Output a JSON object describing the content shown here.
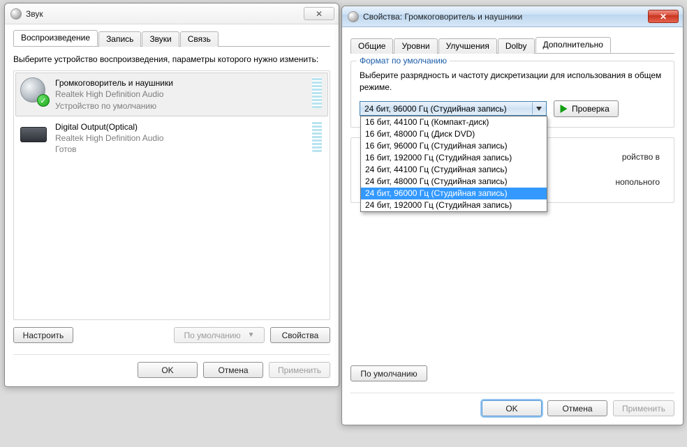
{
  "sound_window": {
    "title": "Звук",
    "tabs": [
      "Воспроизведение",
      "Запись",
      "Звуки",
      "Связь"
    ],
    "active_tab": 0,
    "instruction": "Выберите устройство воспроизведения, параметры которого нужно изменить:",
    "devices": [
      {
        "name": "Громкоговоритель и наушники",
        "driver": "Realtek High Definition Audio",
        "status": "Устройство по умолчанию",
        "selected": true,
        "icon": "speaker",
        "default_check": true
      },
      {
        "name": "Digital Output(Optical)",
        "driver": "Realtek High Definition Audio",
        "status": "Готов",
        "selected": false,
        "icon": "optical",
        "default_check": false
      }
    ],
    "buttons": {
      "configure": "Настроить",
      "set_default": "По умолчанию",
      "properties": "Свойства",
      "ok": "OK",
      "cancel": "Отмена",
      "apply": "Применить"
    }
  },
  "props_window": {
    "title": "Свойства: Громкоговоритель и наушники",
    "tabs": [
      "Общие",
      "Уровни",
      "Улучшения",
      "Dolby",
      "Дополнительно"
    ],
    "active_tab": 4,
    "group_legend": "Формат по умолчанию",
    "group_instruction": "Выберите разрядность и частоту дискретизации для использования в общем режиме.",
    "combo_selected": "24 бит, 96000 Гц (Студийная запись)",
    "combo_options": [
      "16 бит, 44100 Гц (Компакт-диск)",
      "16 бит, 48000 Гц (Диск DVD)",
      "16 бит, 96000 Гц (Студийная запись)",
      "16 бит, 192000 Гц (Студийная запись)",
      "24 бит, 44100 Гц (Студийная запись)",
      "24 бит, 48000 Гц (Студийная запись)",
      "24 бит, 96000 Гц (Студийная запись)",
      "24 бит, 192000 Гц (Студийная запись)"
    ],
    "combo_highlight_index": 6,
    "test_label": "Проверка",
    "obscured_fragments": {
      "line1_suffix": "ройство в",
      "line2_suffix": "нопольного"
    },
    "defaults_button": "По умолчанию",
    "buttons": {
      "ok": "OK",
      "cancel": "Отмена",
      "apply": "Применить"
    }
  }
}
